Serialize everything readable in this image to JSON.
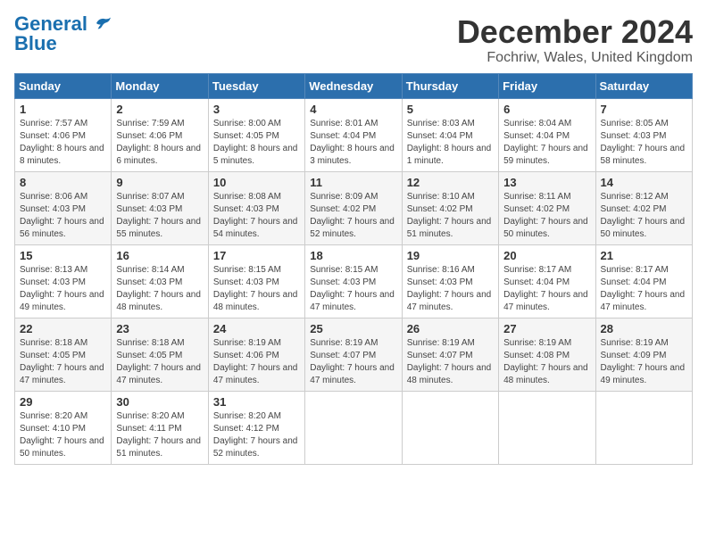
{
  "header": {
    "logo_general": "General",
    "logo_blue": "Blue",
    "month_title": "December 2024",
    "location": "Fochriw, Wales, United Kingdom"
  },
  "weekdays": [
    "Sunday",
    "Monday",
    "Tuesday",
    "Wednesday",
    "Thursday",
    "Friday",
    "Saturday"
  ],
  "weeks": [
    [
      {
        "day": "1",
        "info": "Sunrise: 7:57 AM\nSunset: 4:06 PM\nDaylight: 8 hours and 8 minutes."
      },
      {
        "day": "2",
        "info": "Sunrise: 7:59 AM\nSunset: 4:06 PM\nDaylight: 8 hours and 6 minutes."
      },
      {
        "day": "3",
        "info": "Sunrise: 8:00 AM\nSunset: 4:05 PM\nDaylight: 8 hours and 5 minutes."
      },
      {
        "day": "4",
        "info": "Sunrise: 8:01 AM\nSunset: 4:04 PM\nDaylight: 8 hours and 3 minutes."
      },
      {
        "day": "5",
        "info": "Sunrise: 8:03 AM\nSunset: 4:04 PM\nDaylight: 8 hours and 1 minute."
      },
      {
        "day": "6",
        "info": "Sunrise: 8:04 AM\nSunset: 4:04 PM\nDaylight: 7 hours and 59 minutes."
      },
      {
        "day": "7",
        "info": "Sunrise: 8:05 AM\nSunset: 4:03 PM\nDaylight: 7 hours and 58 minutes."
      }
    ],
    [
      {
        "day": "8",
        "info": "Sunrise: 8:06 AM\nSunset: 4:03 PM\nDaylight: 7 hours and 56 minutes."
      },
      {
        "day": "9",
        "info": "Sunrise: 8:07 AM\nSunset: 4:03 PM\nDaylight: 7 hours and 55 minutes."
      },
      {
        "day": "10",
        "info": "Sunrise: 8:08 AM\nSunset: 4:03 PM\nDaylight: 7 hours and 54 minutes."
      },
      {
        "day": "11",
        "info": "Sunrise: 8:09 AM\nSunset: 4:02 PM\nDaylight: 7 hours and 52 minutes."
      },
      {
        "day": "12",
        "info": "Sunrise: 8:10 AM\nSunset: 4:02 PM\nDaylight: 7 hours and 51 minutes."
      },
      {
        "day": "13",
        "info": "Sunrise: 8:11 AM\nSunset: 4:02 PM\nDaylight: 7 hours and 50 minutes."
      },
      {
        "day": "14",
        "info": "Sunrise: 8:12 AM\nSunset: 4:02 PM\nDaylight: 7 hours and 50 minutes."
      }
    ],
    [
      {
        "day": "15",
        "info": "Sunrise: 8:13 AM\nSunset: 4:03 PM\nDaylight: 7 hours and 49 minutes."
      },
      {
        "day": "16",
        "info": "Sunrise: 8:14 AM\nSunset: 4:03 PM\nDaylight: 7 hours and 48 minutes."
      },
      {
        "day": "17",
        "info": "Sunrise: 8:15 AM\nSunset: 4:03 PM\nDaylight: 7 hours and 48 minutes."
      },
      {
        "day": "18",
        "info": "Sunrise: 8:15 AM\nSunset: 4:03 PM\nDaylight: 7 hours and 47 minutes."
      },
      {
        "day": "19",
        "info": "Sunrise: 8:16 AM\nSunset: 4:03 PM\nDaylight: 7 hours and 47 minutes."
      },
      {
        "day": "20",
        "info": "Sunrise: 8:17 AM\nSunset: 4:04 PM\nDaylight: 7 hours and 47 minutes."
      },
      {
        "day": "21",
        "info": "Sunrise: 8:17 AM\nSunset: 4:04 PM\nDaylight: 7 hours and 47 minutes."
      }
    ],
    [
      {
        "day": "22",
        "info": "Sunrise: 8:18 AM\nSunset: 4:05 PM\nDaylight: 7 hours and 47 minutes."
      },
      {
        "day": "23",
        "info": "Sunrise: 8:18 AM\nSunset: 4:05 PM\nDaylight: 7 hours and 47 minutes."
      },
      {
        "day": "24",
        "info": "Sunrise: 8:19 AM\nSunset: 4:06 PM\nDaylight: 7 hours and 47 minutes."
      },
      {
        "day": "25",
        "info": "Sunrise: 8:19 AM\nSunset: 4:07 PM\nDaylight: 7 hours and 47 minutes."
      },
      {
        "day": "26",
        "info": "Sunrise: 8:19 AM\nSunset: 4:07 PM\nDaylight: 7 hours and 48 minutes."
      },
      {
        "day": "27",
        "info": "Sunrise: 8:19 AM\nSunset: 4:08 PM\nDaylight: 7 hours and 48 minutes."
      },
      {
        "day": "28",
        "info": "Sunrise: 8:19 AM\nSunset: 4:09 PM\nDaylight: 7 hours and 49 minutes."
      }
    ],
    [
      {
        "day": "29",
        "info": "Sunrise: 8:20 AM\nSunset: 4:10 PM\nDaylight: 7 hours and 50 minutes."
      },
      {
        "day": "30",
        "info": "Sunrise: 8:20 AM\nSunset: 4:11 PM\nDaylight: 7 hours and 51 minutes."
      },
      {
        "day": "31",
        "info": "Sunrise: 8:20 AM\nSunset: 4:12 PM\nDaylight: 7 hours and 52 minutes."
      },
      null,
      null,
      null,
      null
    ]
  ]
}
